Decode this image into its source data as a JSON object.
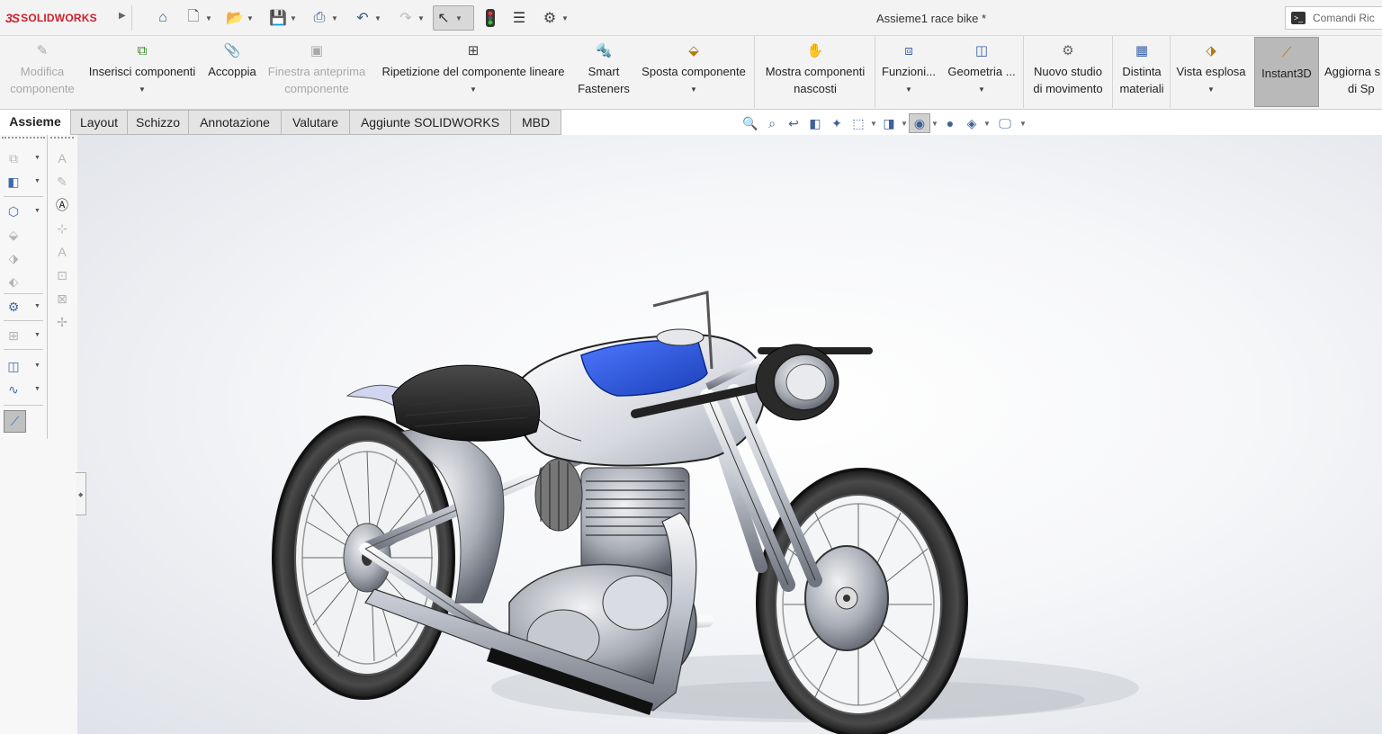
{
  "app": {
    "logo_ds": "3S",
    "logo_text": "SOLIDWORKS"
  },
  "title": "Assieme1 race bike *",
  "search": {
    "placeholder": "Comandi Ric"
  },
  "quick_access": [
    "home-icon",
    "new-document-icon",
    "open-folder-icon",
    "save-icon",
    "print-icon",
    "undo-icon",
    "redo-icon",
    "select-icon",
    "traffic-light-icon",
    "file-properties-icon",
    "settings-icon"
  ],
  "ribbon": {
    "modifica": [
      "Modifica",
      "componente"
    ],
    "inserisci": [
      "Inserisci componenti"
    ],
    "accoppia": [
      "Accoppia"
    ],
    "finestra": [
      "Finestra anteprima",
      "componente"
    ],
    "ripetizione": [
      "Ripetizione del componente lineare"
    ],
    "smart": [
      "Smart",
      "Fasteners"
    ],
    "sposta": [
      "Sposta componente"
    ],
    "mostra": [
      "Mostra componenti",
      "nascosti"
    ],
    "funzioni": [
      "Funzioni..."
    ],
    "geometria": [
      "Geometria ..."
    ],
    "nuovo": [
      "Nuovo studio",
      "di movimento"
    ],
    "distinta": [
      "Distinta",
      "materiali"
    ],
    "vista": [
      "Vista esplosa"
    ],
    "instant3d": [
      "Instant3D"
    ],
    "aggiorna": [
      "Aggiorna s",
      "di Sp"
    ]
  },
  "tabs": [
    "Assieme",
    "Layout",
    "Schizzo",
    "Annotazione",
    "Valutare",
    "Aggiunte SOLIDWORKS",
    "MBD"
  ],
  "active_tab": "Assieme",
  "colors": {
    "tank_accent": "#1f4fd6",
    "brand_red": "#d0202a",
    "active_button": "#b9b9b9"
  }
}
